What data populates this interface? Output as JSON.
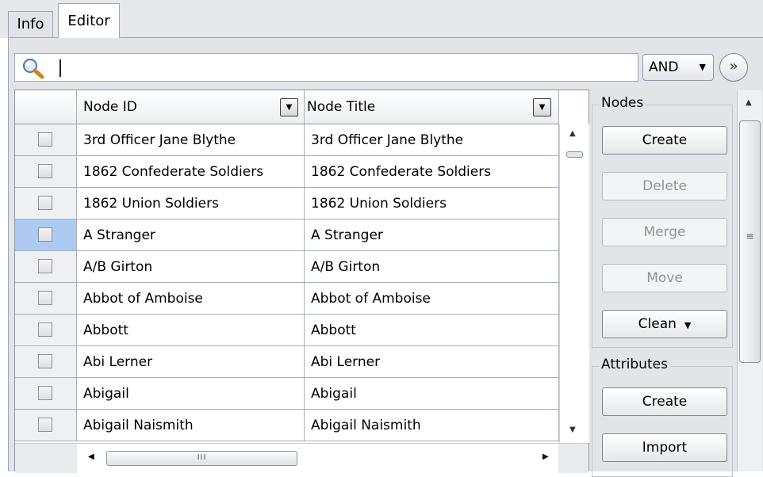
{
  "tabs": [
    {
      "label": "Info",
      "active": false
    },
    {
      "label": "Editor",
      "active": true
    }
  ],
  "search": {
    "value": "",
    "placeholder": ""
  },
  "operator": {
    "selected": "AND"
  },
  "grid": {
    "columns": [
      {
        "label": ""
      },
      {
        "label": "Node ID"
      },
      {
        "label": "Node Title"
      }
    ],
    "rows": [
      {
        "id": "3rd Officer Jane Blythe",
        "title": "3rd Officer Jane Blythe",
        "checked": false,
        "selected": false
      },
      {
        "id": "1862 Confederate Soldiers",
        "title": "1862 Confederate Soldiers",
        "checked": false,
        "selected": false
      },
      {
        "id": "1862 Union Soldiers",
        "title": "1862 Union Soldiers",
        "checked": false,
        "selected": false
      },
      {
        "id": "A Stranger",
        "title": "A Stranger",
        "checked": false,
        "selected": true
      },
      {
        "id": "A/B Girton",
        "title": "A/B Girton",
        "checked": false,
        "selected": false
      },
      {
        "id": "Abbot of Amboise",
        "title": "Abbot of Amboise",
        "checked": false,
        "selected": false
      },
      {
        "id": "Abbott",
        "title": "Abbott",
        "checked": false,
        "selected": false
      },
      {
        "id": "Abi Lerner",
        "title": "Abi Lerner",
        "checked": false,
        "selected": false
      },
      {
        "id": "Abigail",
        "title": "Abigail",
        "checked": false,
        "selected": false
      },
      {
        "id": "Abigail Naismith",
        "title": "Abigail Naismith",
        "checked": false,
        "selected": false
      }
    ],
    "hscroll_thumb": "III"
  },
  "nodes": {
    "title": "Nodes",
    "create": "Create",
    "delete": "Delete",
    "merge": "Merge",
    "move": "Move",
    "clean": "Clean"
  },
  "attributes": {
    "title": "Attributes",
    "create": "Create",
    "import": "Import"
  },
  "icons": {
    "search": "magnifier-icon",
    "expand": "double-chevron-down-icon"
  },
  "colors": {
    "selected_row": "#aecaf2",
    "panel": "#e3e4e8",
    "disabled_text": "#8e949c"
  }
}
